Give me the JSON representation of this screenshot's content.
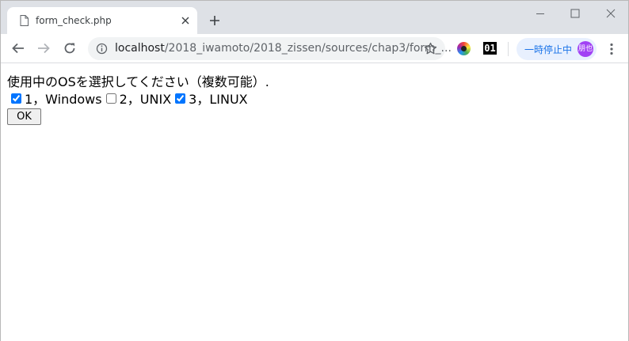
{
  "tab": {
    "title": "form_check.php"
  },
  "omnibox": {
    "url_host": "localhost",
    "url_path": "/2018_iwamoto/2018_zissen/sources/chap3/form_..."
  },
  "extensions": {
    "ext_01_label": "01"
  },
  "profile": {
    "pause_label": "一時停止中",
    "avatar_text": "朋也"
  },
  "page": {
    "question": "使用中のOSを選択してください（複数可能）.",
    "options": [
      {
        "label": "1，Windows",
        "checked": true
      },
      {
        "label": "2，UNIX",
        "checked": false
      },
      {
        "label": "3，LINUX",
        "checked": true
      }
    ],
    "submit_label": "OK"
  },
  "colors": {
    "tabstrip_bg": "#dee1e6",
    "omnibox_bg": "#f1f3f4",
    "accent": "#1a73e8",
    "avatar_bg": "#a142f4"
  }
}
